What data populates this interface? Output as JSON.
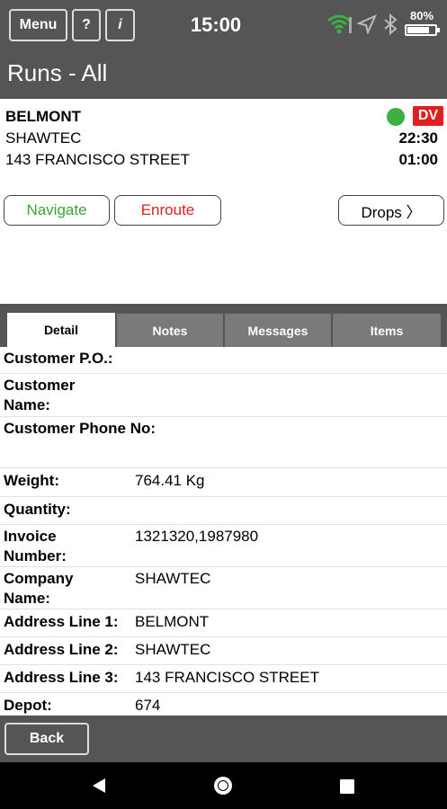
{
  "header": {
    "menu_label": "Menu",
    "help_label": "?",
    "info_label": "i",
    "clock": "15:00",
    "battery_text": "80%",
    "battery_level": 0.8,
    "title": "Runs - All"
  },
  "run": {
    "name": "BELMONT",
    "company": "SHAWTEC",
    "address": "143 FRANCISCO STREET",
    "status_badge": "DV",
    "time_1": "22:30",
    "time_2": "01:00",
    "status_dot_color": "#3cb043",
    "badge_color": "#e21e1e"
  },
  "actions": {
    "navigate_label": "Navigate",
    "navigate_color": "#3aa53a",
    "enroute_label": "Enroute",
    "enroute_color": "#e02020",
    "drops_label": "Drops 〉"
  },
  "tabs": [
    {
      "label": "Detail",
      "active": true
    },
    {
      "label": "Notes",
      "active": false
    },
    {
      "label": "Messages",
      "active": false
    },
    {
      "label": "Items",
      "active": false
    }
  ],
  "details": [
    {
      "label": "Customer P.O.:",
      "value": ""
    },
    {
      "label": "Customer Name:",
      "value": ""
    },
    {
      "label": "Customer Phone No:",
      "value": ""
    },
    {
      "label": "Weight:",
      "value": "764.41 Kg"
    },
    {
      "label": "Quantity:",
      "value": ""
    },
    {
      "label": "Invoice Number:",
      "value": "1321320,1987980"
    },
    {
      "label": "Company Name:",
      "value": "SHAWTEC"
    },
    {
      "label": "Address Line 1:",
      "value": "BELMONT"
    },
    {
      "label": "Address Line 2:",
      "value": "SHAWTEC"
    },
    {
      "label": "Address Line 3:",
      "value": "143 FRANCISCO STREET"
    },
    {
      "label": "Depot:",
      "value": "674"
    }
  ],
  "footer": {
    "back_label": "Back"
  },
  "icons": {
    "wifi": "wifi-icon",
    "location": "location-arrow-icon",
    "bluetooth": "bluetooth-icon",
    "battery": "battery-icon",
    "nav_back": "nav-back-icon",
    "nav_home": "nav-home-icon",
    "nav_recent": "nav-recent-icon"
  }
}
